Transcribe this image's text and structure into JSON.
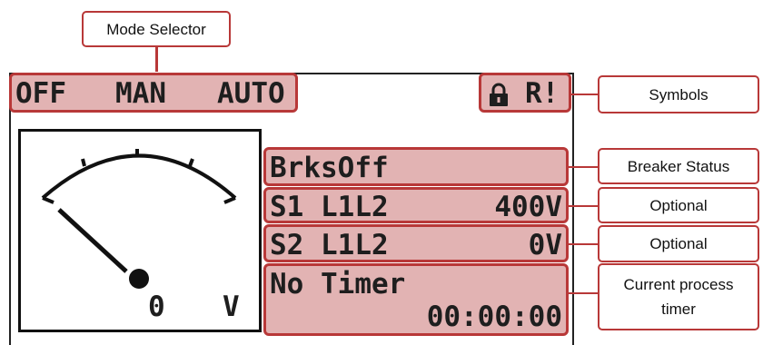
{
  "mode_selector": {
    "callout_label": "Mode Selector",
    "modes": [
      {
        "label": "OFF"
      },
      {
        "label": "MAN"
      },
      {
        "label": "AUTO"
      }
    ]
  },
  "symbols": {
    "callout_label": "Symbols",
    "lock_icon": "lock-icon",
    "alarm_text": "R!"
  },
  "gauge": {
    "value": "0",
    "unit": "V"
  },
  "rows": {
    "breaker": {
      "text": "BrksOff",
      "callout_label": "Breaker Status"
    },
    "s1": {
      "label": "S1 L1L2",
      "value": "400V",
      "callout_label": "Optional"
    },
    "s2": {
      "label": "S2 L1L2",
      "value": "0V",
      "callout_label": "Optional"
    },
    "timer": {
      "label": "No Timer",
      "value": "00:00:00",
      "callout_label_line1": "Current process",
      "callout_label_line2": "timer"
    }
  },
  "colors": {
    "highlight_fill": "#e2b3b3",
    "highlight_border": "#b83838",
    "display_text": "#1e1e1e"
  }
}
